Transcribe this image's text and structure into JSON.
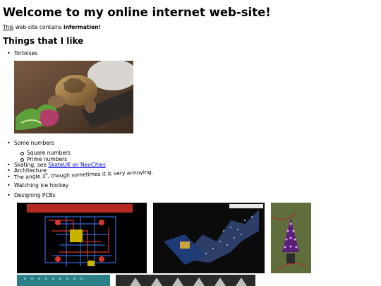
{
  "heading": "Welcome to my online internet web-site!",
  "intro": {
    "link_text": "This",
    "text": " web-site contains ",
    "bold": "information!"
  },
  "subheading": "Things that I like",
  "items": {
    "tortoises": "Tortoises",
    "numbers": "Some numbers",
    "square_numbers": "Square numbers",
    "prime_numbers": "Prime numbers",
    "skating_prefix": "Skating, see ",
    "skating_link": "SkateUK on NeoCities",
    "architecture": "Architecture",
    "angle_prefix": "The angle 3",
    "angle_sup": "o",
    "angle_suffix": ", though sometimes it is very annoying.",
    "ice_hockey": "Watching ice hockey",
    "pcbs": "Designing PCBs"
  },
  "images": {
    "tortoise": "tortoise-photo",
    "pcb_layout": "pcb-layout-image",
    "pcb_tree": "christmas-tree-pcb-render",
    "pcb_photo": "lit-tree-pcb-photo",
    "pcb_teal": "teal-pcb-photo",
    "pcb_dark": "dark-pcb-photo"
  },
  "colors": {
    "link": "#0000ee"
  }
}
